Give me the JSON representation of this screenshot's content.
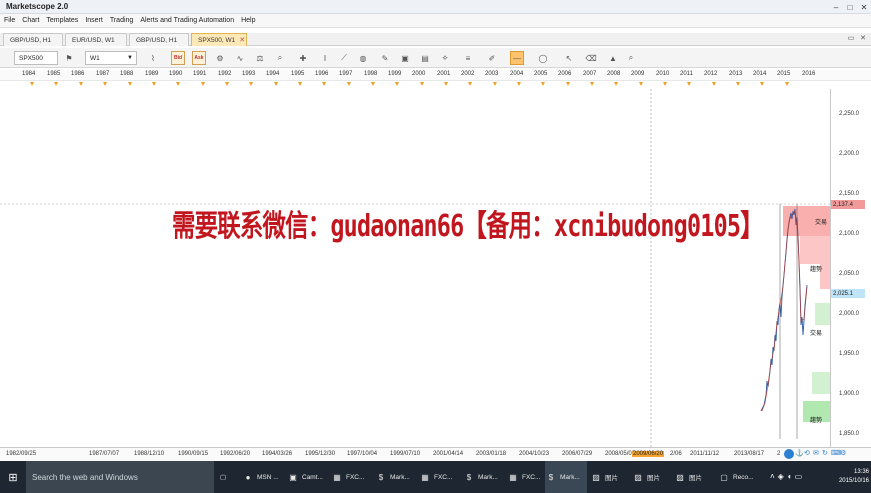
{
  "window": {
    "title": "Marketscope 2.0"
  },
  "menu": [
    "File",
    "Chart",
    "Templates",
    "Insert",
    "Trading",
    "Alerts and Trading Automation",
    "Help"
  ],
  "tabs": [
    {
      "label": "GBP/USD, H1",
      "active": false
    },
    {
      "label": "EUR/USD, W1",
      "active": false
    },
    {
      "label": "GBP/USD, H1",
      "active": false
    },
    {
      "label": "SPX500, W1",
      "active": true
    }
  ],
  "toolbar": {
    "instrument": "SPX500",
    "timeframe": "W1",
    "bid_label": "Bid",
    "ask_label": "Ask"
  },
  "year_axis": [
    "1984",
    "1985",
    "1986",
    "1987",
    "1988",
    "1989",
    "1990",
    "1991",
    "1992",
    "1993",
    "1994",
    "1995",
    "1996",
    "1997",
    "1998",
    "1999",
    "2000",
    "2001",
    "2002",
    "2003",
    "2004",
    "2005",
    "2006",
    "2007",
    "2008",
    "2009",
    "2010",
    "2011",
    "2012",
    "2013",
    "2014",
    "2015",
    "2016"
  ],
  "price_axis": [
    "2,250.0",
    "2,200.0",
    "2,150.0",
    "2,100.0",
    "2,050.0",
    "2,000.0",
    "1,950.0",
    "1,900.0",
    "1,850.0"
  ],
  "price_tags": {
    "high": "2,137.4",
    "current": "2,025.1"
  },
  "chart_labels": {
    "zone1": "交易",
    "zone2": "趨勢",
    "zone3": "交易",
    "zone4": "趨勢"
  },
  "date_axis": [
    "1982/09/25",
    "1987/07/07",
    "1988/12/10",
    "1990/09/15",
    "1992/06/20",
    "1994/03/26",
    "1995/12/30",
    "1997/10/04",
    "1999/07/10",
    "2001/04/14",
    "2003/01/18",
    "2004/10/23",
    "2006/07/29",
    "2008/05/03",
    "2009/06/20",
    "2011/11/12",
    "2013/08/17"
  ],
  "date_axis_extra": {
    "after_selected": "2/06",
    "tail": "2"
  },
  "overlay_text": "需要联系微信：gudaonan66【备用：xcnibudong0105】",
  "taskbar": {
    "search_placeholder": "Search the web and Windows",
    "items": [
      "MSN ...",
      "Camt...",
      "FXC...",
      "Mark...",
      "FXC...",
      "Mark...",
      "FXC...",
      "Mark...",
      "图片",
      "图片",
      "图片",
      "Reco..."
    ],
    "time": "13:36",
    "date": "2015/10/16"
  },
  "colors": {
    "accent_tab": "#fde9b7",
    "overlay": "#c2161f",
    "bull": "#c0392b",
    "bear": "#2c5aa0"
  }
}
